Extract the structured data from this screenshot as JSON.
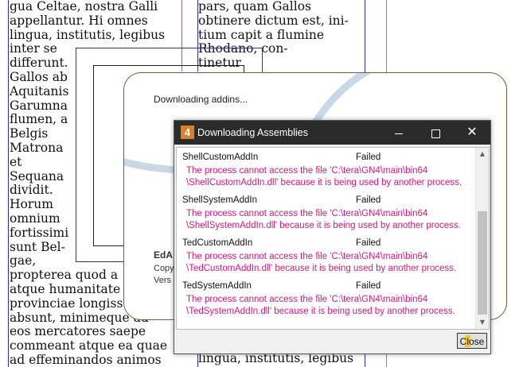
{
  "background_doc": {
    "left_column": "gua Celtae, nostra Galli\nappellantur. Hi omnes\nlingua, institutis, legibus\ninter se\ndifferunt.\nGallos ab\nAquitanis\nGarumna\nflumen, a\nBelgis\nMatrona\net\nSequana\ndividit.\nHorum\nomnium\nfortissimi\nsunt Bel-\ngae,\npropterea quod a\natque humanitate\nprovinciae longiss\nabsunt, minimeque ad\neos mercatores saepe\ncommeant atque ea quae\nad effeminandos animos",
    "right_column": "pars, quam Gallos\nobtinere dictum est, ini-\ntium capit a flumine\nRhodano, con-\ntinetur",
    "right_column_bottom": "lingua, institutis, legibus"
  },
  "splash": {
    "status_text": "Downloading addins...",
    "product_text": "EdA",
    "copyright_text": "Copy",
    "version_text": "Vers"
  },
  "dialog": {
    "app_icon_text": "4",
    "title": "Downloading Assemblies",
    "minimize_icon": "minimize-icon",
    "maximize_icon": "maximize-icon",
    "close_icon": "close-icon",
    "entries": [
      {
        "name": "ShellCustomAddIn",
        "status": "Failed",
        "message": "The process cannot access the file 'C:\\tera\\GN4\\main\\bin64\n\\ShellCustomAddIn.dll' because it is being used by another process."
      },
      {
        "name": "ShellSystemAddIn",
        "status": "Failed",
        "message": "The process cannot access the file 'C:\\tera\\GN4\\main\\bin64\n\\ShellSystemAddIn.dll' because it is being used by another process."
      },
      {
        "name": "TedCustomAddIn",
        "status": "Failed",
        "message": "The process cannot access the file 'C:\\tera\\GN4\\main\\bin64\n\\TedCustomAddIn.dll' because it is being used by another process."
      },
      {
        "name": "TedSystemAddIn",
        "status": "Failed",
        "message": "The process cannot access the file 'C:\\tera\\GN4\\main\\bin64\n\\TedSystemAddIn.dll' because it is being used by another process."
      }
    ],
    "close_button_label": "Close"
  },
  "colors": {
    "error_text": "#e0157a",
    "titlebar": "#2b2b2b",
    "app_icon": "#d9822b",
    "splash_border": "#7a5a3c"
  }
}
